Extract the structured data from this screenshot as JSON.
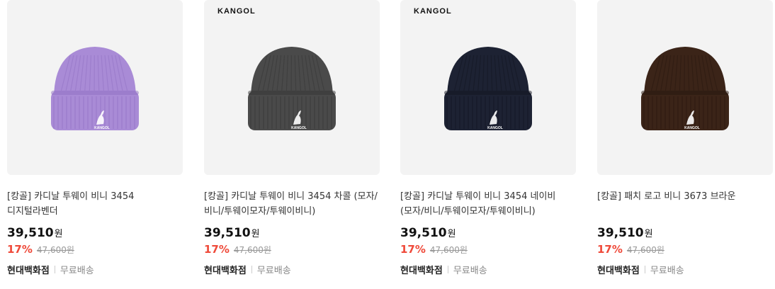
{
  "products": [
    {
      "brand_mark": "",
      "title": "[캉골] 카디날 투웨이 비니 3454 디지털라벤더",
      "price": "39,510",
      "currency": "원",
      "discount_rate": "17%",
      "original_price": "47,600원",
      "seller": "현대백화점",
      "shipping": "무료배송",
      "hat_color": "#a98bd6",
      "hat_shade": "#8f6fc2",
      "logo_text": "KANGOL"
    },
    {
      "brand_mark": "KANGOL",
      "title": "[캉골] 카디날 투웨이 비니 3454 차콜 (모자/비니/투웨이모자/투웨이비니)",
      "price": "39,510",
      "currency": "원",
      "discount_rate": "17%",
      "original_price": "47,600원",
      "seller": "현대백화점",
      "shipping": "무료배송",
      "hat_color": "#4a4a4a",
      "hat_shade": "#333333",
      "logo_text": "KANGOL"
    },
    {
      "brand_mark": "KANGOL",
      "title": "[캉골] 카디날 투웨이 비니 3454 네이비 (모자/비니/투웨이모자/투웨이비니)",
      "price": "39,510",
      "currency": "원",
      "discount_rate": "17%",
      "original_price": "47,600원",
      "seller": "현대백화점",
      "shipping": "무료배송",
      "hat_color": "#1d2233",
      "hat_shade": "#11141f",
      "logo_text": "KANGOL"
    },
    {
      "brand_mark": "",
      "title": "[캉골] 패치 로고 비니 3673 브라운",
      "price": "39,510",
      "currency": "원",
      "discount_rate": "17%",
      "original_price": "47,600원",
      "seller": "현대백화점",
      "shipping": "무료배송",
      "hat_color": "#3b2418",
      "hat_shade": "#26160e",
      "logo_text": "KANGOL"
    }
  ],
  "colors": {
    "discount": "#ef4a3a",
    "thumb_bg": "#f3f3f3"
  }
}
